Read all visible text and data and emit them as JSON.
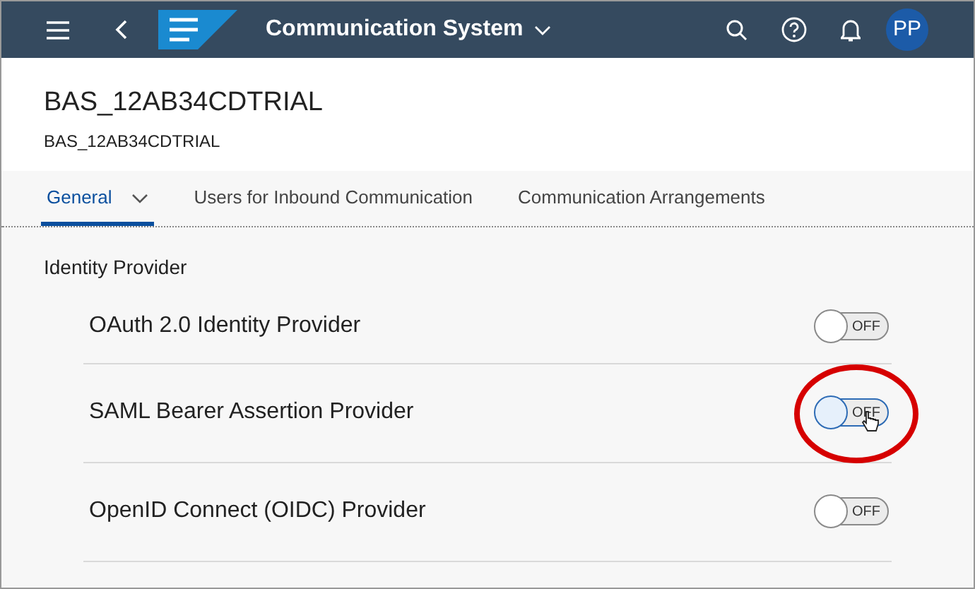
{
  "shell_bar": {
    "title": "Communication System",
    "avatar": "PP"
  },
  "header": {
    "title": "BAS_12AB34CDTRIAL",
    "subtitle": "BAS_12AB34CDTRIAL"
  },
  "tabs": [
    {
      "label": "General",
      "selected": true,
      "has_menu": true
    },
    {
      "label": "Users for Inbound Communication",
      "selected": false,
      "has_menu": false
    },
    {
      "label": "Communication Arrangements",
      "selected": false,
      "has_menu": false
    }
  ],
  "section": {
    "title": "Identity Provider",
    "items": [
      {
        "label": "OAuth 2.0 Identity Provider",
        "on": false,
        "state_text": "OFF",
        "focused": false
      },
      {
        "label": "SAML Bearer Assertion Provider",
        "on": false,
        "state_text": "OFF",
        "focused": true
      },
      {
        "label": "OpenID Connect (OIDC) Provider",
        "on": false,
        "state_text": "OFF",
        "focused": false
      }
    ]
  }
}
